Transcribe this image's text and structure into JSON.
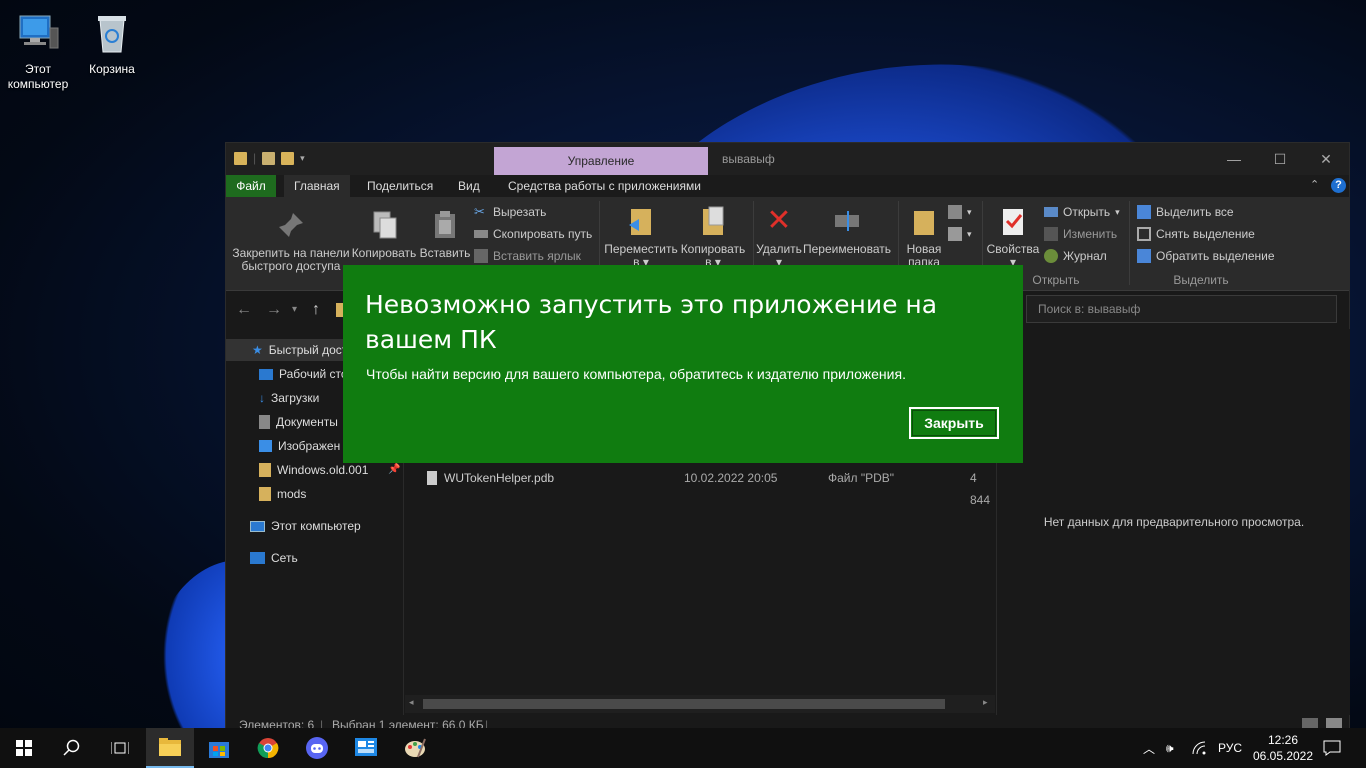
{
  "desktop": {
    "icons": [
      {
        "label": "Этот компьютер"
      },
      {
        "label": "Корзина"
      }
    ]
  },
  "window": {
    "context_tab": "Управление",
    "title": "вывавыф",
    "tabs": [
      "Файл",
      "Главная",
      "Поделиться",
      "Вид",
      "Средства работы с приложениями"
    ],
    "ribbon": {
      "pin": "Закрепить на панели быстрого доступа",
      "pin_line1": "Закрепить на панели",
      "pin_line2": "быстрого доступа",
      "copy": "Копировать",
      "paste": "Вставить",
      "cut": "Вырезать",
      "copy_path": "Скопировать путь",
      "paste_shortcut": "Вставить ярлык",
      "move_to_l1": "Переместить",
      "move_to_l2": "в",
      "copy_to_l1": "Копировать",
      "copy_to_l2": "в",
      "delete": "Удалить",
      "rename": "Переименовать",
      "new_folder_l1": "Новая",
      "new_folder_l2": "папка",
      "properties": "Свойства",
      "open": "Открыть",
      "edit": "Изменить",
      "history": "Журнал",
      "group_open": "Открыть",
      "select_all": "Выделить все",
      "select_none": "Снять выделение",
      "invert_selection": "Обратить выделение",
      "group_select": "Выделить"
    },
    "search_placeholder": "Поиск в: вывавыф",
    "nav": {
      "quick_access": "Быстрый дост",
      "desktop": "Рабочий сто",
      "downloads": "Загрузки",
      "documents": "Документы",
      "pictures": "Изображен",
      "windows_old": "Windows.old.001",
      "mods": "mods",
      "this_pc": "Этот компьютер",
      "network": "Сеть"
    },
    "file": {
      "name": "WUTokenHelper.pdb",
      "date": "10.02.2022 20:05",
      "type": "Файл \"PDB\"",
      "size": "4 844"
    },
    "preview_text": "Нет данных для предварительного просмотра.",
    "status": {
      "items": "Элементов: 6",
      "selected": "Выбран 1 элемент: 66,0 КБ"
    }
  },
  "dialog": {
    "title": "Невозможно запустить это приложение на вашем ПК",
    "message": "Чтобы найти версию для вашего компьютера, обратитесь к издателю приложения.",
    "close_button": "Закрыть"
  },
  "taskbar": {
    "language": "РУС",
    "time": "12:26",
    "date": "06.05.2022"
  }
}
